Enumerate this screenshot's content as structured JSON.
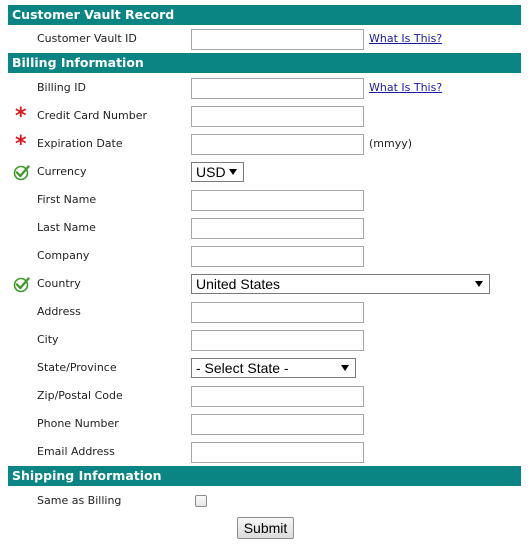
{
  "sections": {
    "vault": "Customer Vault Record",
    "billing": "Billing Information",
    "shipping": "Shipping Information"
  },
  "vault": {
    "id_label": "Customer Vault ID",
    "id_value": "",
    "help_link": "What Is This?"
  },
  "billing": {
    "billing_id_label": "Billing ID",
    "billing_id_value": "",
    "help_link": "What Is This?",
    "cc_label": "Credit Card Number",
    "cc_value": "",
    "exp_label": "Expiration Date",
    "exp_value": "",
    "exp_hint": "(mmyy)",
    "currency_label": "Currency",
    "currency_value": "USD",
    "first_name_label": "First Name",
    "last_name_label": "Last Name",
    "company_label": "Company",
    "country_label": "Country",
    "country_value": "United States",
    "address_label": "Address",
    "city_label": "City",
    "state_label": "State/Province",
    "state_value": "- Select State -",
    "zip_label": "Zip/Postal Code",
    "phone_label": "Phone Number",
    "email_label": "Email Address"
  },
  "shipping": {
    "same_label": "Same as Billing",
    "same_checked": false
  },
  "submit_label": "Submit",
  "colors": {
    "section_bg": "#0b8583",
    "required": "#e0141e",
    "link": "#1a1aa6",
    "valid": "#3f9a2b"
  }
}
